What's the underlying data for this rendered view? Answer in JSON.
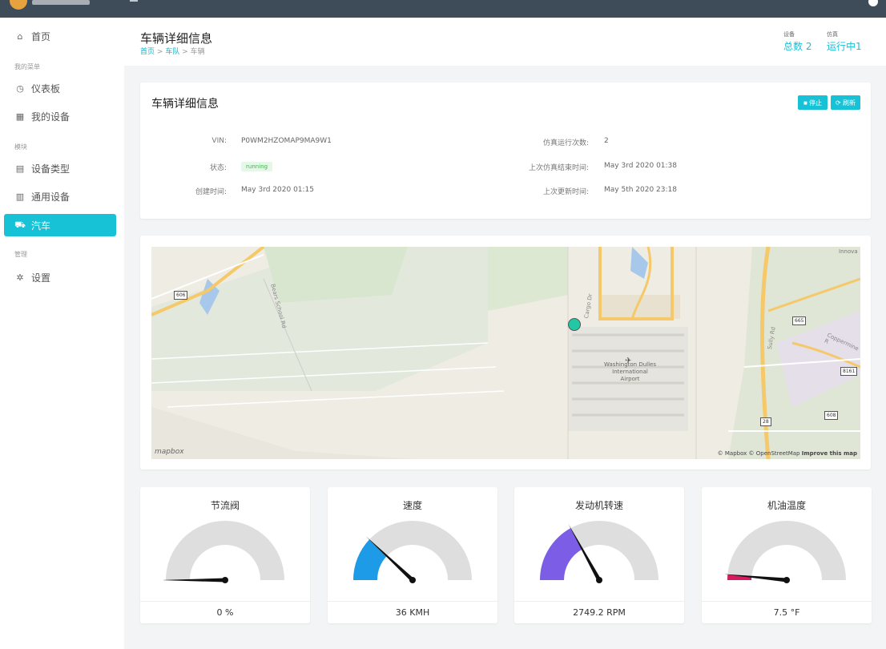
{
  "sidebar": {
    "items": [
      {
        "label": "首页",
        "icon": "home-icon"
      },
      {
        "label": "仪表板",
        "icon": "dashboard-icon"
      },
      {
        "label": "我的设备",
        "icon": "grid-icon"
      },
      {
        "label": "设备类型",
        "icon": "document-icon"
      },
      {
        "label": "通用设备",
        "icon": "table-icon"
      },
      {
        "label": "汽车",
        "icon": "car-icon"
      },
      {
        "label": "设置",
        "icon": "gear-icon"
      }
    ],
    "groups": {
      "my_menu": "我的菜单",
      "modules": "模块",
      "manage": "管理"
    }
  },
  "header": {
    "title": "车辆详细信息",
    "breadcrumb": [
      "首页",
      "车队",
      "车辆"
    ],
    "breadcrumb_sep": ">",
    "stats": [
      {
        "label": "设备",
        "value": "总数 2"
      },
      {
        "label": "仿真",
        "value": "运行中1"
      }
    ]
  },
  "details": {
    "title": "车辆详细信息",
    "stop_label": "■ 停止",
    "refresh_label": "⟳ 刷新",
    "fields_left": [
      {
        "label": "VIN:",
        "value": "P0WM2HZOMAP9MA9W1"
      },
      {
        "label": "状态:",
        "value": "running"
      },
      {
        "label": "创建时间:",
        "value": "May 3rd 2020 01:15"
      }
    ],
    "fields_right": [
      {
        "label": "仿真运行次数:",
        "value": "2"
      },
      {
        "label": "上次仿真结束时间:",
        "value": "May 3rd 2020 01:38"
      },
      {
        "label": "上次更新时间:",
        "value": "May 5th 2020 23:18"
      }
    ]
  },
  "map": {
    "logo": "mapbox",
    "credit": "© Mapbox © OpenStreetMap ",
    "credit_link": "Improve this map",
    "labels": {
      "airport": "Washington Dulles\nInternational\nAirport",
      "innovation": "Innova",
      "cargo": "Cargo Dr",
      "school": "Bears School Rd",
      "sully": "Sully Rd",
      "coppermine": "Coppermine R"
    },
    "shields": [
      "606",
      "665",
      "8161",
      "28",
      "608"
    ]
  },
  "gauges": [
    {
      "title": "节流阀",
      "value": "0 %",
      "fraction": 0.0,
      "color": "#d32f2f"
    },
    {
      "title": "速度",
      "value": "36 KMH",
      "fraction": 0.24,
      "color": "#1e9be6"
    },
    {
      "title": "发动机转速",
      "value": "2749.2 RPM",
      "fraction": 0.34,
      "color": "#7c5ee6"
    },
    {
      "title": "机油温度",
      "value": "7.5 °F",
      "fraction": 0.03,
      "color": "#d81b60"
    }
  ]
}
